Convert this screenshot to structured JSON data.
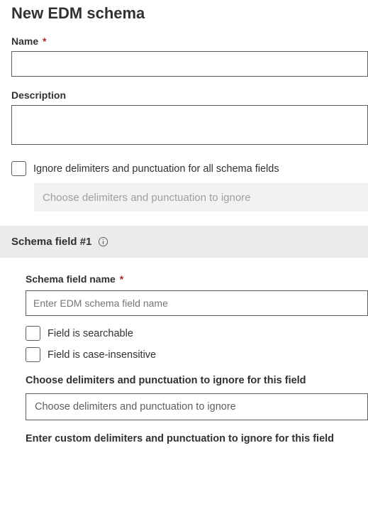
{
  "header": {
    "title": "New EDM schema"
  },
  "form": {
    "name": {
      "label": "Name",
      "required": "*",
      "value": ""
    },
    "description": {
      "label": "Description",
      "value": ""
    },
    "ignoreAll": {
      "label": "Ignore delimiters and punctuation for all schema fields",
      "dropdownPlaceholder": "Choose delimiters and punctuation to ignore"
    }
  },
  "schemaField": {
    "headerLabel": "Schema field #1",
    "name": {
      "label": "Schema field name",
      "required": "*",
      "placeholder": "Enter EDM schema field name"
    },
    "searchable": {
      "label": "Field is searchable"
    },
    "caseInsensitive": {
      "label": "Field is case-insensitive"
    },
    "chooseDelimiters": {
      "label": "Choose delimiters and punctuation to ignore for this field",
      "placeholder": "Choose delimiters and punctuation to ignore"
    },
    "customDelimiters": {
      "label": "Enter custom delimiters and punctuation to ignore for this field"
    }
  }
}
